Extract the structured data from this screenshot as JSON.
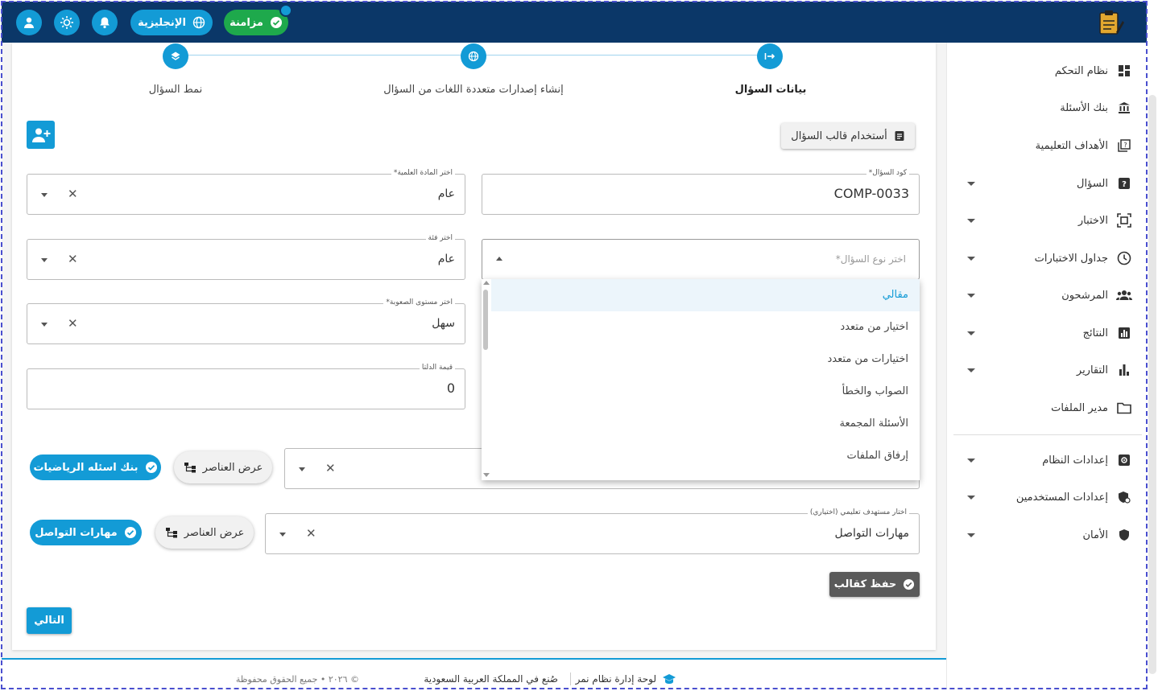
{
  "topbar": {
    "language_label": "الإنجليزية",
    "sync_label": "مزامنة",
    "colors": {
      "bar": "#0b3768",
      "accent": "#139bd6",
      "sync": "#1ea94c"
    },
    "icons": [
      "user-icon",
      "sun-icon",
      "bell-icon",
      "globe-icon",
      "check-circle-icon",
      "logo-icon"
    ]
  },
  "steps": [
    {
      "label": "بيانات السؤال",
      "active": true,
      "icon": "arrow-right-bar-icon"
    },
    {
      "label": "إنشاء إصدارات متعددة اللغات من السؤال",
      "active": false,
      "icon": "globe-icon"
    },
    {
      "label": "نمط السؤال",
      "active": false,
      "icon": "layers-icon"
    }
  ],
  "template_button_label": "أستخدام قالب السؤال",
  "fields": {
    "question_code": {
      "label": "كود السؤال*",
      "value": "COMP-0033"
    },
    "subject": {
      "label": "اختر المادة العلمية*",
      "value": "عام"
    },
    "category": {
      "label": "اختر فئة",
      "value": "عام"
    },
    "question_type": {
      "placeholder": "اختر نوع السؤال*"
    },
    "difficulty": {
      "label": "اختر مستوى الصعوبة*",
      "value": "سهل"
    },
    "delta": {
      "label": "قيمة الدلتا",
      "value": "0"
    },
    "learning_target": {
      "label": "اختار مستهدف تعليمي (اختياري)",
      "value": "مهارات التواصل"
    }
  },
  "dropdown_options": [
    "مقالي",
    "اختيار من متعدد",
    "اختيارات من متعدد",
    "الصواب والخطأ",
    "الأسئلة المجمعة",
    "إرفاق الملفات"
  ],
  "dropdown_selected": "مقالي",
  "chips": {
    "math_bank": "بنك اسئله الرياضيات",
    "communication": "مهارات التواصل",
    "show_elements": "عرض العناصر"
  },
  "save_template_label": "حفظ كقالب",
  "next_label": "التالي",
  "sidebar": {
    "items": [
      {
        "label": "نظام التحكم",
        "icon": "dashboard-icon",
        "expandable": false
      },
      {
        "label": "بنك الأسئلة",
        "icon": "bank-icon",
        "expandable": false
      },
      {
        "label": "الأهداف التعليمية",
        "icon": "quiz-icon",
        "expandable": false
      },
      {
        "label": "السؤال",
        "icon": "help-box-icon",
        "expandable": true
      },
      {
        "label": "الاختبار",
        "icon": "exam-frame-icon",
        "expandable": true
      },
      {
        "label": "جداول الاختبارات",
        "icon": "clock-icon",
        "expandable": true
      },
      {
        "label": "المرشحون",
        "icon": "people-icon",
        "expandable": true
      },
      {
        "label": "النتائج",
        "icon": "chart-box-icon",
        "expandable": true
      },
      {
        "label": "التقارير",
        "icon": "bar-chart-icon",
        "expandable": true
      },
      {
        "label": "مدير الملفات",
        "icon": "folder-icon",
        "expandable": false
      }
    ],
    "settings_items": [
      {
        "label": "إعدادات النظام",
        "icon": "settings-box-icon",
        "expandable": true
      },
      {
        "label": "إعدادات المستخدمين",
        "icon": "user-shield-icon",
        "expandable": true
      },
      {
        "label": "الأمان",
        "icon": "shield-icon",
        "expandable": true
      }
    ]
  },
  "footer": {
    "dashboard": "لوحة إدارة نظام نمر",
    "made_in": "صُنع في المملكة العربية السعودية",
    "copyright": "© ٢٠٢٦ • جميع الحقوق محفوظة"
  }
}
